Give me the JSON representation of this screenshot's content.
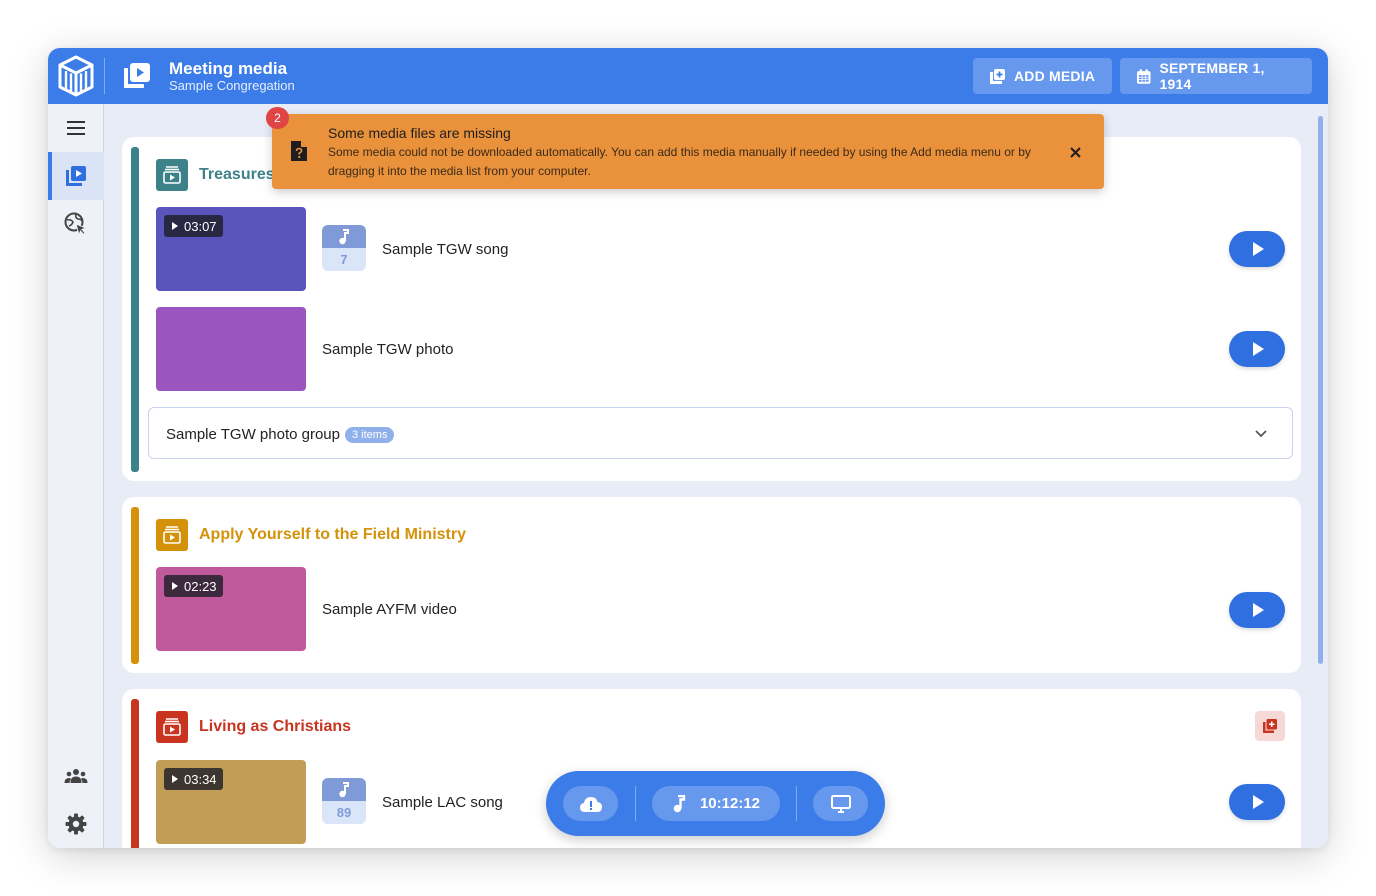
{
  "header": {
    "title": "Meeting media",
    "subtitle": "Sample Congregation",
    "add_media_label": "ADD MEDIA",
    "date_label": "SEPTEMBER 1, 1914",
    "accent_color": "#3b7ce8"
  },
  "sidebar": {
    "items": [
      {
        "name": "menu",
        "icon": "menu-icon"
      },
      {
        "name": "meeting-media",
        "icon": "media-library-icon",
        "active": true
      },
      {
        "name": "present-website",
        "icon": "globe-cursor-icon"
      },
      {
        "name": "congregations",
        "icon": "people-group-icon"
      },
      {
        "name": "settings",
        "icon": "gear-icon"
      }
    ]
  },
  "toast": {
    "count": "2",
    "title": "Some media files are missing",
    "body": "Some media could not be downloaded automatically. You can add this media manually if needed by using the Add media menu or by dragging it into the media list from your computer.",
    "color": "#e9913b"
  },
  "sections": [
    {
      "title": "Treasures",
      "color": "#3d8289",
      "items": [
        {
          "kind": "video",
          "duration": "03:07",
          "song_number": "7",
          "label": "Sample TGW song",
          "thumb_color": "#5a55bd"
        },
        {
          "kind": "photo",
          "label": "Sample TGW photo",
          "thumb_color": "#9b55be"
        }
      ],
      "group": {
        "label": "Sample TGW photo group",
        "chip": "3 items"
      }
    },
    {
      "title": "Apply Yourself to the Field Ministry",
      "color": "#d4920a",
      "items": [
        {
          "kind": "video",
          "duration": "02:23",
          "label": "Sample AYFM video",
          "thumb_color": "#c05a9c"
        }
      ]
    },
    {
      "title": "Living as Christians",
      "color": "#c8341f",
      "items": [
        {
          "kind": "video",
          "duration": "03:34",
          "song_number": "89",
          "label": "Sample LAC song",
          "thumb_color": "#c29d55"
        }
      ]
    }
  ],
  "bottom_bar": {
    "clock": "10:12:12"
  }
}
